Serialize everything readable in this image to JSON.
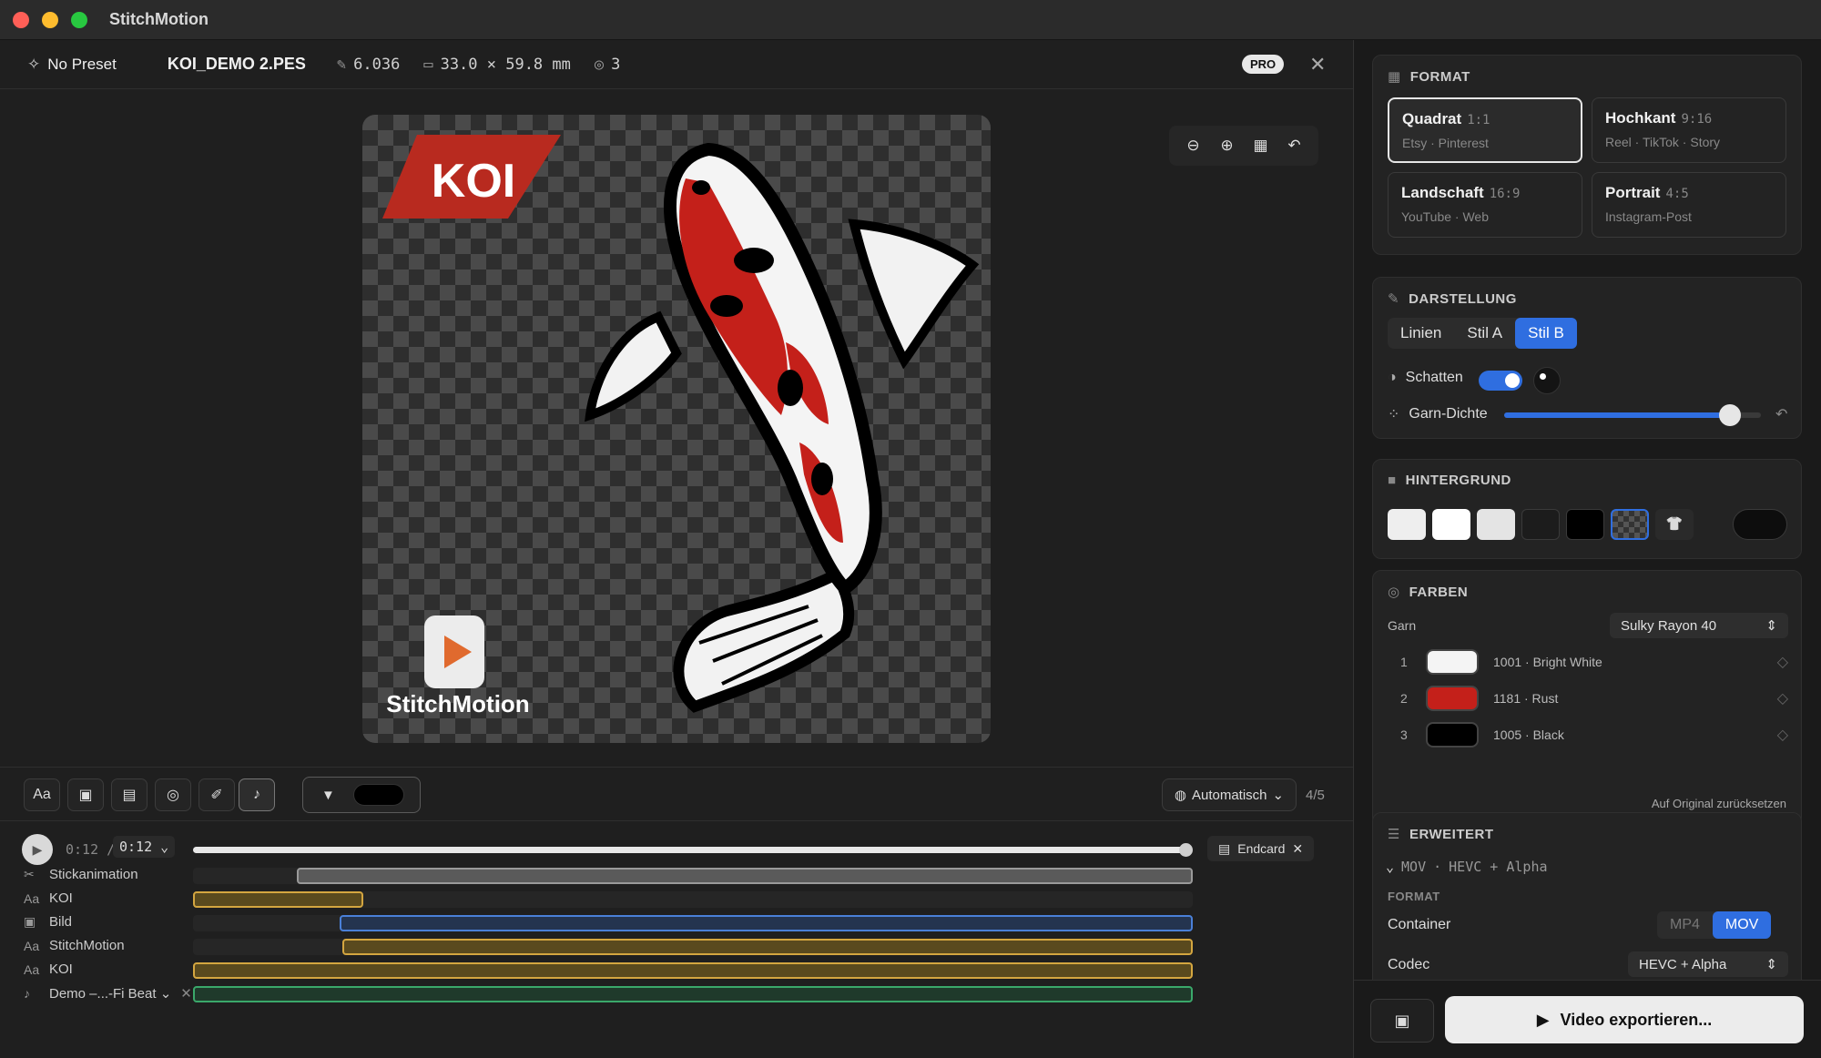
{
  "window": {
    "title": "StitchMotion"
  },
  "info": {
    "preset": "No Preset",
    "file": "KOI_DEMO 2.PES",
    "stitches": "6.036",
    "size": "33.0 × 59.8 mm",
    "colors": "3",
    "badge": "PRO"
  },
  "canvas": {
    "banner_text": "KOI",
    "logo_text": "StitchMotion"
  },
  "toolbar": {
    "text_tool": "Aa",
    "auto_label": "Automatisch",
    "page_count": "4/5"
  },
  "timeline": {
    "current": "0:12",
    "separator": "/",
    "total": "0:12",
    "endcard": "Endcard",
    "progress": 1.0,
    "duration": 12,
    "tracks": [
      {
        "icon": "scissors-icon",
        "glyph": "✂",
        "label": "Stickanimation",
        "color": "grey",
        "start": 0.104,
        "end": 1.0
      },
      {
        "icon": "text-icon",
        "glyph": "Aa",
        "label": "KOI",
        "color": "gold",
        "start": 0.0,
        "end": 0.17
      },
      {
        "icon": "image-icon",
        "glyph": "▣",
        "label": "Bild",
        "color": "blue",
        "start": 0.147,
        "end": 1.0
      },
      {
        "icon": "text-icon",
        "glyph": "Aa",
        "label": "StitchMotion",
        "color": "gold",
        "start": 0.149,
        "end": 1.0
      },
      {
        "icon": "text-icon",
        "glyph": "Aa",
        "label": "KOI",
        "color": "gold",
        "start": 0.0,
        "end": 1.0
      },
      {
        "icon": "music-icon",
        "glyph": "♪",
        "label": "Demo –...-Fi Beat ⌄",
        "color": "green",
        "start": 0.0,
        "end": 1.0
      }
    ]
  },
  "panel": {
    "format": {
      "title": "FORMAT",
      "options": [
        {
          "name": "Quadrat",
          "ratio": "1:1",
          "sub": "Etsy · Pinterest",
          "selected": true
        },
        {
          "name": "Hochkant",
          "ratio": "9:16",
          "sub": "Reel · TikTok · Story",
          "selected": false
        },
        {
          "name": "Landschaft",
          "ratio": "16:9",
          "sub": "YouTube · Web",
          "selected": false
        },
        {
          "name": "Portrait",
          "ratio": "4:5",
          "sub": "Instagram-Post",
          "selected": false
        }
      ]
    },
    "display": {
      "title": "DARSTELLUNG",
      "styles": [
        "Linien",
        "Stil A",
        "Stil B"
      ],
      "active_style": "Stil B",
      "shadow_label": "Schatten",
      "shadow_on": true,
      "density_label": "Garn-Dichte",
      "density": 0.88
    },
    "background": {
      "title": "HINTERGRUND",
      "swatches": [
        "#eeeeee",
        "#ffffff",
        "#e4e4e4",
        "#1c1c1c",
        "#000000",
        "checker",
        "shirt",
        "#0d0d0d"
      ],
      "selected": 5
    },
    "colors": {
      "title": "FARBEN",
      "yarn_label": "Garn",
      "yarn_brand": "Sulky Rayon 40",
      "items": [
        {
          "num": "1",
          "hex": "#f4f4f4",
          "name": "1001 · Bright White"
        },
        {
          "num": "2",
          "hex": "#c4201a",
          "name": "1181 · Rust"
        },
        {
          "num": "3",
          "hex": "#000000",
          "name": "1005 · Black"
        }
      ],
      "reset": "Auf Original zurücksetzen"
    },
    "advanced": {
      "title": "ERWEITERT",
      "summary_pre": "MOV",
      "summary_dot": "·",
      "summary_post": "HEVC + Alpha",
      "section": "FORMAT",
      "container_label": "Container",
      "container_opts": [
        "MP4",
        "MOV"
      ],
      "container_active": "MOV",
      "codec_label": "Codec",
      "codec_value": "HEVC + Alpha"
    },
    "export_label": "Video exportieren..."
  }
}
